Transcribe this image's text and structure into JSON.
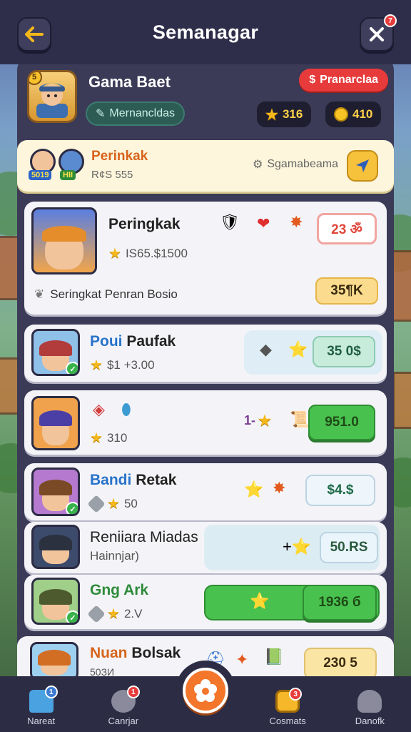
{
  "header": {
    "title": "Semanagar",
    "close_badge": "7"
  },
  "profile": {
    "name": "Gama Baet",
    "level": "5",
    "status": "Mernancldas",
    "red_pill": "Pranarclaa",
    "currency_1": "316",
    "currency_2": "410"
  },
  "banner": {
    "title": "Perinkak",
    "sub": "R¢S 555",
    "badge_1": "5019",
    "badge_2": "HII",
    "label": "Sgamabeama"
  },
  "rows": [
    {
      "name": "Peringkak",
      "sub": "IS65.$1500",
      "score": "23 ॐ",
      "extra_label": "Seringkat Penran Bosio",
      "extra_score": "35¶K"
    },
    {
      "name_a": "Poui",
      "name_b": "Paufak",
      "sub": "$1 +3.00",
      "score": "35 0$"
    },
    {
      "name": "",
      "sub": "310",
      "prefix": "1‑",
      "score": "951.0"
    },
    {
      "name_a": "Bandi",
      "name_b": "Retak",
      "sub": "50",
      "score": "$4.$"
    },
    {
      "name": "Reniiara Miadas",
      "sub": "Hainnjar)",
      "score": "50.RS"
    },
    {
      "name_a": "Gng",
      "name_b": "Ark",
      "sub": "2.V",
      "score": "1936 б"
    },
    {
      "name_a": "Nuan",
      "name_b": "Bolsak",
      "sub": "50ЗИ",
      "score": "230 5"
    }
  ],
  "nav": {
    "items": [
      {
        "label": "Nareat",
        "badge": "1"
      },
      {
        "label": "Canrjar",
        "badge": "1"
      },
      {
        "label": "Cosmats",
        "badge": "3"
      },
      {
        "label": "Danofk",
        "badge": ""
      }
    ]
  },
  "colors": {
    "topbar": "#2f2e4a",
    "accent_orange": "#f3762a",
    "accent_red": "#e73b3b",
    "accent_green": "#48c14e"
  }
}
